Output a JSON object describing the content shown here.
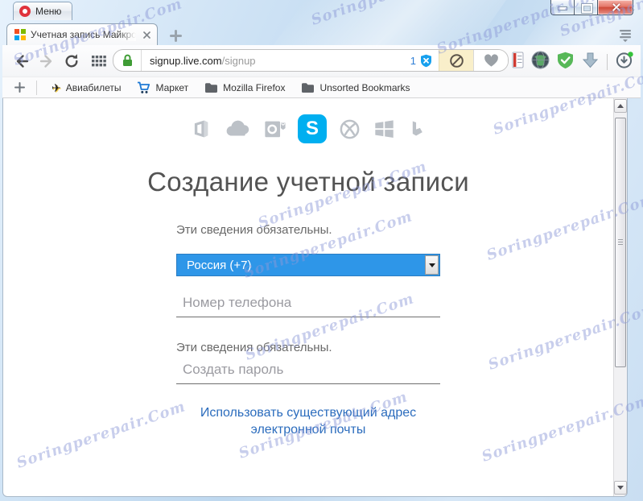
{
  "window": {
    "menu_label": "Меню"
  },
  "tabs": {
    "active_title": "Учетная запись Майкрос"
  },
  "address": {
    "host": "signup.live.com",
    "path": "/signup",
    "blocked_count": "1"
  },
  "bookmarks": {
    "items": [
      {
        "label": "Авиабилеты",
        "icon": "airplane-icon"
      },
      {
        "label": "Маркет",
        "icon": "cart-icon"
      },
      {
        "label": "Mozilla Firefox",
        "icon": "folder-icon"
      },
      {
        "label": "Unsorted Bookmarks",
        "icon": "folder-icon"
      }
    ],
    "airplane_glyph": "✈"
  },
  "page": {
    "services": [
      "office",
      "onedrive",
      "outlook",
      "skype",
      "xbox",
      "windows",
      "bing"
    ],
    "skype_letter": "S",
    "heading": "Создание учетной записи",
    "required_note": "Эти сведения обязательны.",
    "country_select": {
      "value": "Россия (+7)"
    },
    "phone_placeholder": "Номер телефона",
    "required_note_2": "Эти сведения обязательны.",
    "password_placeholder": "Создать пароль",
    "email_link": "Использовать существующий адрес электронной почты"
  },
  "watermark": {
    "text": "Soringperepair.Com"
  },
  "colors": {
    "select_blue": "#2e96e8",
    "skype_blue": "#00aff0",
    "link_blue": "#2b6cbd",
    "close_red": "#cf4a38",
    "shield_badge_blue": "#17a0ee",
    "block_bg_cream": "#f9efca"
  }
}
